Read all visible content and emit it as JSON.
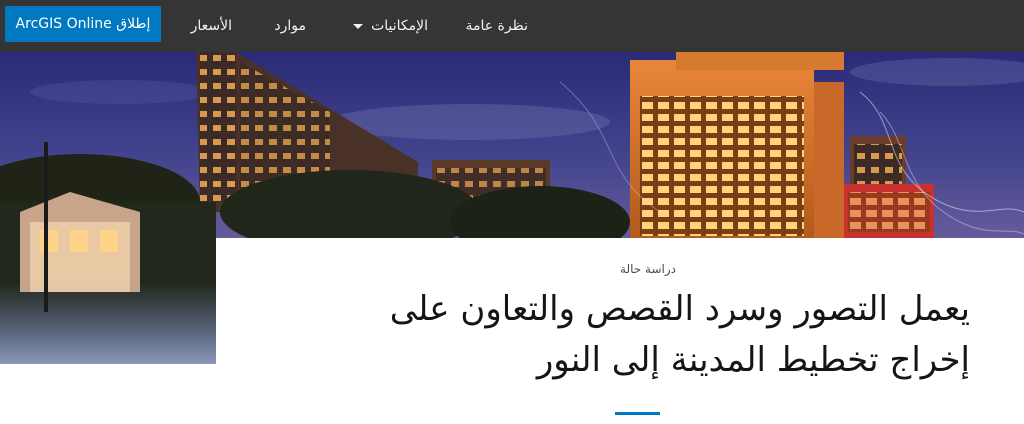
{
  "nav": {
    "launch_label": "إطلاق ArcGIS Online",
    "items": [
      {
        "label": "نظرة عامة"
      },
      {
        "label": "الإمكانيات"
      },
      {
        "label": "موارد"
      },
      {
        "label": "الأسعار"
      }
    ]
  },
  "hero": {
    "eyebrow": "دراسة حالة",
    "headline_line1": "يعمل التصور وسرد القصص والتعاون على",
    "headline_line2": "إخراج تخطيط المدينة إلى النور"
  },
  "colors": {
    "topbar": "#353535",
    "accent": "#0079c1",
    "text": "#151515"
  }
}
